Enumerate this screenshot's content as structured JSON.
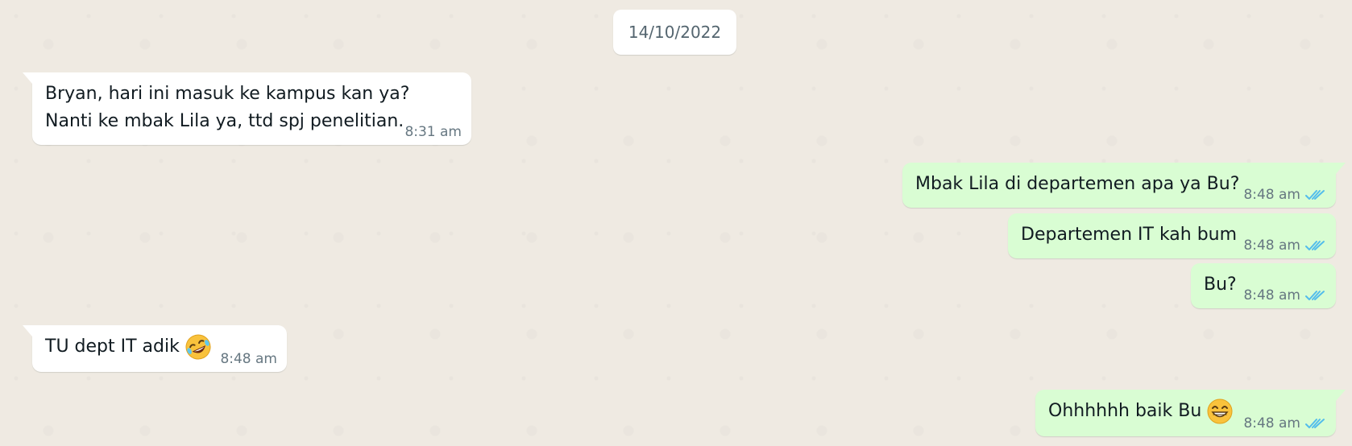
{
  "date_label": "14/10/2022",
  "colors": {
    "background": "#efeae2",
    "incoming_bubble": "#ffffff",
    "outgoing_bubble": "#d9fdd3",
    "read_ticks": "#53bdeb",
    "meta_text": "#667781"
  },
  "messages": [
    {
      "direction": "incoming",
      "text": "Bryan, hari ini masuk ke kampus kan ya?\nNanti ke mbak Lila ya, ttd spj penelitian.",
      "time": "8:31 am"
    },
    {
      "direction": "outgoing",
      "text": "Mbak Lila di departemen apa ya Bu?",
      "time": "8:48 am",
      "status_icon": "double-check-read-icon"
    },
    {
      "direction": "outgoing",
      "text": "Departemen IT kah bum",
      "time": "8:48 am",
      "status_icon": "double-check-read-icon"
    },
    {
      "direction": "outgoing",
      "text": "Bu?",
      "time": "8:48 am",
      "status_icon": "double-check-read-icon"
    },
    {
      "direction": "incoming",
      "text": "TU dept IT adik",
      "emoji": "rolling-on-floor-laughing-emoji",
      "time": "8:48 am"
    },
    {
      "direction": "outgoing",
      "text": "Ohhhhhh baik Bu",
      "emoji": "beaming-face-emoji",
      "time": "8:48 am",
      "status_icon": "double-check-read-icon"
    }
  ]
}
